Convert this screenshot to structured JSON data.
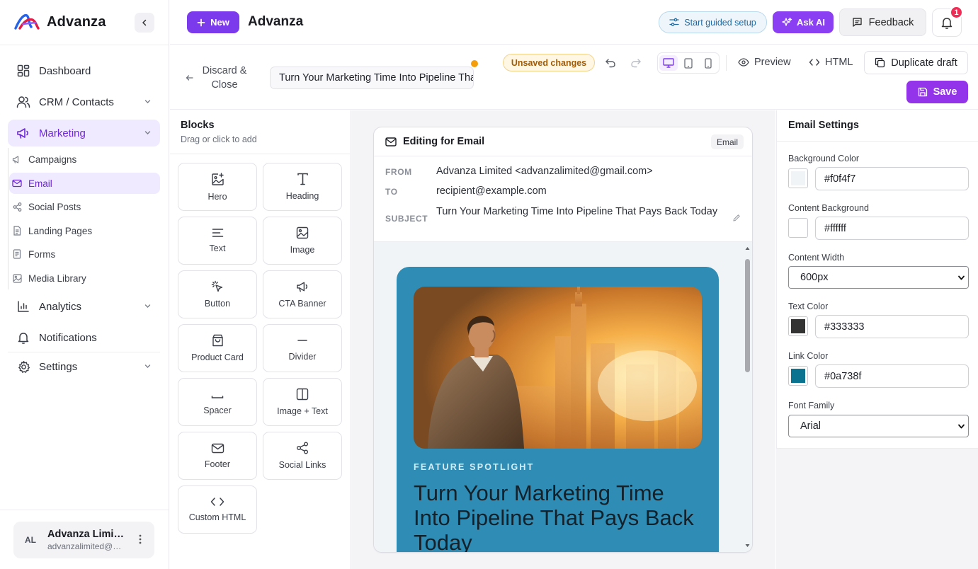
{
  "brand": {
    "name": "Advanza",
    "accent": "#7c3aed"
  },
  "sidebar": {
    "items": [
      {
        "label": "Dashboard",
        "icon": "grid-icon"
      },
      {
        "label": "CRM / Contacts",
        "icon": "users-icon"
      },
      {
        "label": "Marketing",
        "icon": "megaphone-icon"
      },
      {
        "label": "Analytics",
        "icon": "bar-chart-icon"
      },
      {
        "label": "Notifications",
        "icon": "bell-icon"
      },
      {
        "label": "Settings",
        "icon": "gear-icon"
      }
    ],
    "marketing_sub": [
      {
        "label": "Campaigns",
        "icon": "megaphone-small-icon"
      },
      {
        "label": "Email",
        "icon": "mail-icon"
      },
      {
        "label": "Social Posts",
        "icon": "share-icon"
      },
      {
        "label": "Landing Pages",
        "icon": "file-icon"
      },
      {
        "label": "Forms",
        "icon": "form-icon"
      },
      {
        "label": "Media Library",
        "icon": "image-icon"
      }
    ],
    "account": {
      "initials": "AL",
      "name": "Advanza Limited",
      "email": "advanzalimited@gmail.com"
    }
  },
  "topbar": {
    "new_label": "New",
    "title": "Advanza",
    "guided_label": "Start guided setup",
    "ai_label": "Ask AI",
    "feedback_label": "Feedback",
    "notification_count": "1"
  },
  "editor": {
    "discard_label": "Discard & Close",
    "subject_value": "Turn Your Marketing Time Into Pipeline That Pays Back Today",
    "unsaved_label": "Unsaved changes",
    "preview_label": "Preview",
    "html_label": "HTML",
    "duplicate_label": "Duplicate draft",
    "save_label": "Save"
  },
  "blocks": {
    "title": "Blocks",
    "subtitle": "Drag or click to add",
    "items": [
      {
        "label": "Hero",
        "icon": "image-plus-icon"
      },
      {
        "label": "Heading",
        "icon": "heading-icon"
      },
      {
        "label": "Text",
        "icon": "text-lines-icon"
      },
      {
        "label": "Image",
        "icon": "image-icon"
      },
      {
        "label": "Button",
        "icon": "pointer-click-icon"
      },
      {
        "label": "CTA Banner",
        "icon": "megaphone-icon"
      },
      {
        "label": "Product Card",
        "icon": "shopping-bag-icon"
      },
      {
        "label": "Divider",
        "icon": "minus-icon"
      },
      {
        "label": "Spacer",
        "icon": "spacer-icon"
      },
      {
        "label": "Image + Text",
        "icon": "columns-icon"
      },
      {
        "label": "Footer",
        "icon": "mail-icon"
      },
      {
        "label": "Social Links",
        "icon": "share-icon"
      },
      {
        "label": "Custom HTML",
        "icon": "code-icon"
      }
    ]
  },
  "email": {
    "header_title": "Editing for Email",
    "header_tag": "Email",
    "from_label": "FROM",
    "from_value": "Advanza Limited <advanzalimited@gmail.com>",
    "to_label": "TO",
    "to_value": "recipient@example.com",
    "subject_label": "SUBJECT",
    "subject_value": "Turn Your Marketing Time Into Pipeline That Pays Back Today",
    "eyebrow": "FEATURE SPOTLIGHT",
    "hero_title": "Turn Your Marketing Time Into Pipeline That Pays Back Today"
  },
  "settings": {
    "title": "Email Settings",
    "background_color": {
      "label": "Background Color",
      "value": "#f0f4f7"
    },
    "content_background": {
      "label": "Content Background",
      "value": "#ffffff"
    },
    "content_width": {
      "label": "Content Width",
      "value": "600px"
    },
    "text_color": {
      "label": "Text Color",
      "value": "#333333"
    },
    "link_color": {
      "label": "Link Color",
      "value": "#0a738f"
    },
    "font_family": {
      "label": "Font Family",
      "value": "Arial"
    }
  }
}
